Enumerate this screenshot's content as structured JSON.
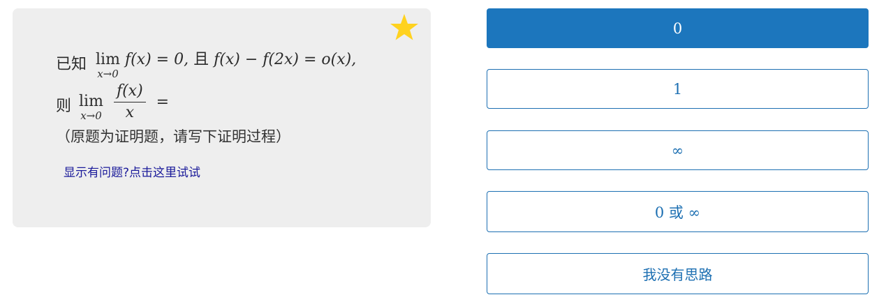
{
  "question": {
    "line1_prefix": "已知",
    "line1_lim": "lim",
    "line1_lim_sub": "x→0",
    "line1_expr_a": "f(x) = 0,",
    "line1_mid": "且",
    "line1_expr_b": "f(x) − f(2x) = o(x),",
    "line2_prefix": "则",
    "line2_lim": "lim",
    "line2_lim_sub": "x→0",
    "line2_frac_num": "f(x)",
    "line2_frac_den": "x",
    "line2_eq": "=",
    "note": "（原题为证明题，请写下证明过程）",
    "help_link": "显示有问题?点击这里试试",
    "star_icon": "star-icon",
    "star_color": "#FFD21F"
  },
  "options": [
    {
      "label": "0",
      "selected": true
    },
    {
      "label": "1",
      "selected": false
    },
    {
      "label": "∞",
      "selected": false
    },
    {
      "label": "0 或 ∞",
      "selected": false
    },
    {
      "label": "我没有思路",
      "selected": false
    }
  ],
  "colors": {
    "accent": "#1c76bd",
    "card_bg": "#eeeeee",
    "link": "#1a1a9a"
  }
}
